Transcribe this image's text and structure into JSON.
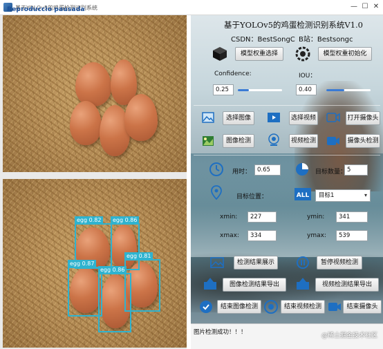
{
  "window": {
    "title": "基于YOLOv5的鸡蛋检测识别系统",
    "overlay_text": "Reproduccio pausada",
    "minimize": "—",
    "maximize": "☐",
    "close": "✕"
  },
  "header": {
    "title": "基于YOLOv5的鸡蛋检测识别系统V1.0",
    "csdn": "CSDN：BestSongC",
    "bilibili": "B站：Bestsongc"
  },
  "model": {
    "select_label": "模型权重选择",
    "init_label": "模型权重初始化"
  },
  "params": {
    "confidence_label": "Confidence:",
    "confidence_value": "0.25",
    "confidence_fraction": 0.25,
    "iou_label": "IOU：",
    "iou_value": "0.40",
    "iou_fraction": 0.4
  },
  "actions": {
    "select_image": "选择图像",
    "select_video": "选择视频",
    "open_camera": "打开摄像头",
    "image_detect": "图像检测",
    "video_detect": "视频检测",
    "camera_detect": "摄像头检测"
  },
  "results": {
    "time_label": "用时：",
    "time_value": "0.65",
    "count_label": "目标数量：",
    "count_value": "5",
    "position_label": "目标位置：",
    "target_select": "目标1",
    "xmin_label": "xmin:",
    "xmin_value": "227",
    "ymin_label": "ymin:",
    "ymin_value": "341",
    "xmax_label": "xmax:",
    "xmax_value": "334",
    "ymax_label": "ymax:",
    "ymax_value": "539"
  },
  "bottom_actions": {
    "show_results": "检测结果展示",
    "pause_video": "暂停视频检测",
    "export_image": "图像检测结果导出",
    "export_video": "视频检测结果导出",
    "end_image": "结束图像检测",
    "end_video": "结束视频检测",
    "end_camera": "结束摄像头"
  },
  "status": {
    "message": "图片检测成功！！！",
    "corner_mark": "@稀土掘金技术社区"
  },
  "detections": [
    {
      "label": "egg 0.82"
    },
    {
      "label": "egg 0.86"
    },
    {
      "label": "egg 0.87"
    },
    {
      "label": "egg 0.86"
    },
    {
      "label": "egg 0.81"
    }
  ],
  "colors": {
    "accent": "#3a7bd5",
    "detection_box": "#2fb3cf"
  }
}
